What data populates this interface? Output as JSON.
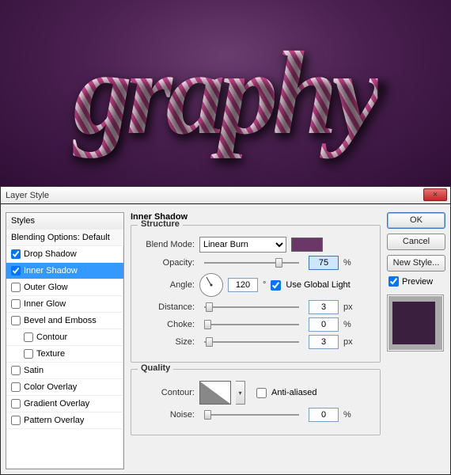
{
  "canvas": {
    "sample_text": "graphy"
  },
  "dialog": {
    "title": "Layer Style",
    "close_glyph": "×",
    "styles_panel": {
      "header": "Styles",
      "blending": "Blending Options: Default",
      "items": [
        {
          "label": "Drop Shadow",
          "checked": true,
          "selected": false
        },
        {
          "label": "Inner Shadow",
          "checked": true,
          "selected": true
        },
        {
          "label": "Outer Glow",
          "checked": false,
          "selected": false
        },
        {
          "label": "Inner Glow",
          "checked": false,
          "selected": false
        },
        {
          "label": "Bevel and Emboss",
          "checked": false,
          "selected": false
        },
        {
          "label": "Contour",
          "checked": false,
          "selected": false,
          "indent": true
        },
        {
          "label": "Texture",
          "checked": false,
          "selected": false,
          "indent": true
        },
        {
          "label": "Satin",
          "checked": false,
          "selected": false
        },
        {
          "label": "Color Overlay",
          "checked": false,
          "selected": false
        },
        {
          "label": "Gradient Overlay",
          "checked": false,
          "selected": false
        },
        {
          "label": "Pattern Overlay",
          "checked": false,
          "selected": false
        }
      ]
    },
    "settings": {
      "heading": "Inner Shadow",
      "structure_label": "Structure",
      "blend_mode_label": "Blend Mode:",
      "blend_mode_value": "Linear Burn",
      "color_swatch": "#6a3766",
      "opacity_label": "Opacity:",
      "opacity_value": "75",
      "opacity_unit": "%",
      "opacity_thumb_pct": 75,
      "angle_label": "Angle:",
      "angle_value": "120",
      "angle_unit": "°",
      "use_global_label": "Use Global Light",
      "use_global_checked": true,
      "distance_label": "Distance:",
      "distance_value": "3",
      "distance_unit": "px",
      "choke_label": "Choke:",
      "choke_value": "0",
      "choke_unit": "%",
      "size_label": "Size:",
      "size_value": "3",
      "size_unit": "px",
      "quality_label": "Quality",
      "contour_label": "Contour:",
      "antialiased_label": "Anti-aliased",
      "antialiased_checked": false,
      "noise_label": "Noise:",
      "noise_value": "0",
      "noise_unit": "%"
    },
    "buttons": {
      "ok": "OK",
      "cancel": "Cancel",
      "new_style": "New Style...",
      "preview": "Preview"
    }
  }
}
